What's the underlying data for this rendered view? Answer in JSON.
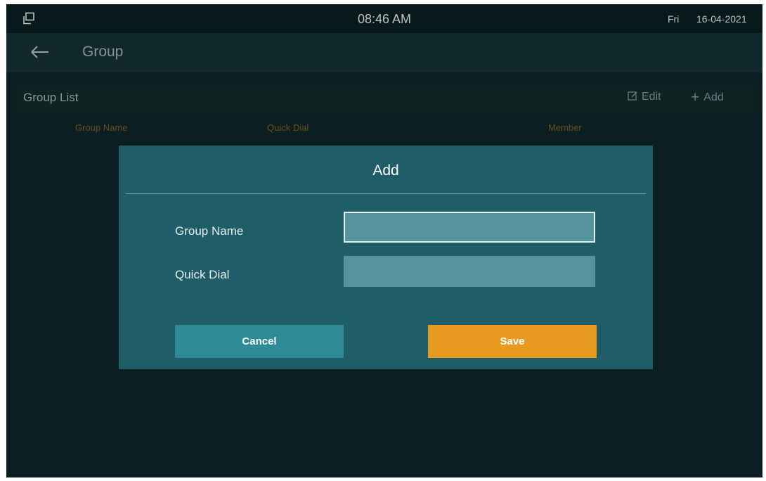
{
  "status_bar": {
    "time": "08:46 AM",
    "day": "Fri",
    "date": "16-04-2021",
    "app_icon": "window-restore-icon"
  },
  "header": {
    "back_icon": "arrow-left-icon",
    "title": "Group"
  },
  "group_list": {
    "label": "Group List",
    "edit_label": "Edit",
    "edit_icon": "edit-icon",
    "add_label": "Add",
    "add_icon": "plus-icon",
    "columns": [
      "Group Name",
      "Quick Dial",
      "Member"
    ]
  },
  "dialog": {
    "title": "Add",
    "fields": [
      {
        "label": "Group Name",
        "value": "",
        "focused": true
      },
      {
        "label": "Quick Dial",
        "value": "",
        "focused": false
      }
    ],
    "cancel_label": "Cancel",
    "save_label": "Save"
  },
  "colors": {
    "background": "#0f2a2f",
    "dialog": "#1f5d68",
    "input": "#55949c",
    "cancel_button": "#2d8a96",
    "save_button": "#e8991f",
    "column_header": "#8a6a1f"
  }
}
